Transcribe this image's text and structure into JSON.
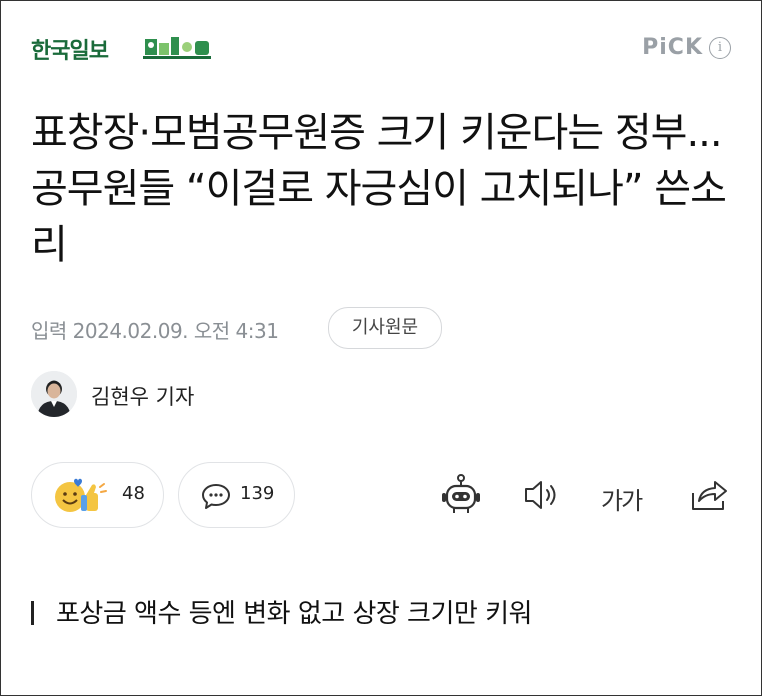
{
  "header": {
    "brand": "한국일보",
    "pick_label": "PiCK",
    "info_symbol": "i"
  },
  "article": {
    "headline": "표창장·모범공무원증 크기 키운다는 정부... 공무원들 “이걸로 자긍심이 고치되나” 쓴소리",
    "date_line": "입력 2024.02.09. 오전 4:31",
    "origin_button": "기사원문",
    "author": "김현우 기자",
    "subheading": "포상금 액수 등엔 변화 없고 상장 크기만 키워"
  },
  "reactions": {
    "like_count": "48",
    "comment_count": "139"
  },
  "toolbar": {
    "font_size_label": "가가"
  },
  "colors": {
    "brand_green": "#1a6b3a",
    "muted_gray": "#9aa0a6",
    "reaction_yellow": "#f4c542"
  },
  "icons": [
    "brand-logo-icon",
    "info-icon",
    "avatar",
    "reaction-emoji-icon",
    "comment-icon",
    "robot-icon",
    "speaker-icon",
    "font-size-icon",
    "share-icon"
  ]
}
